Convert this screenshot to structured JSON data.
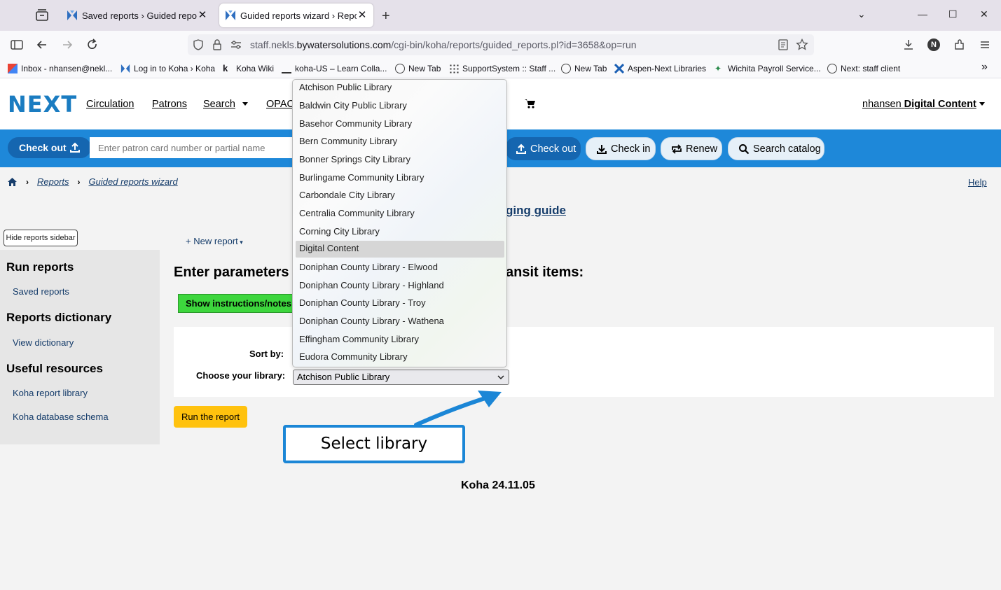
{
  "browser": {
    "tabs": [
      {
        "title": "Saved reports › Guided reports › Reports",
        "active": false
      },
      {
        "title": "Guided reports wizard › Reports",
        "active": true
      }
    ],
    "url": {
      "prefix": "staff.nekls.",
      "domain": "bywatersolutions.com",
      "path": "/cgi-bin/koha/reports/guided_reports.pl?id=3658&op=run"
    },
    "profile_initial": "N",
    "bookmarks": [
      "Inbox - nhansen@nekl...",
      "Log in to Koha › Koha",
      "Koha Wiki",
      "koha-US – Learn Colla...",
      "New Tab",
      "SupportSystem :: Staff ...",
      "New Tab",
      "Aspen-Next Libraries",
      "Wichita Payroll Service...",
      "Next: staff client"
    ]
  },
  "koha": {
    "logo": "NEXT",
    "nav": [
      "Circulation",
      "Patrons",
      "Search",
      "OPAC"
    ],
    "user": {
      "name": "nhansen",
      "branch": "Digital Content"
    },
    "checkout_label": "Check out",
    "patron_placeholder": "Enter patron card number or partial name",
    "bluebar_buttons": [
      "Check out",
      "Check in",
      "Renew",
      "Search catalog"
    ],
    "breadcrumb": [
      "Reports",
      "Guided reports wizard"
    ],
    "help": "Help",
    "guide_fragment": "ging guide",
    "hide_sidebar": "Hide reports sidebar",
    "sidebar": {
      "run_reports": "Run reports",
      "saved_reports": "Saved reports",
      "dictionary": "Reports dictionary",
      "view_dictionary": "View dictionary",
      "useful": "Useful resources",
      "report_library": "Koha report library",
      "db_schema": "Koha database schema"
    },
    "new_report": "New report",
    "heading_left": "Enter parameters",
    "heading_right": "ansit items:",
    "show_instructions": "Show instructions/notes",
    "sort_by_label": "Sort by:",
    "library_label": "Choose your library:",
    "selected_library": "Atchison Public Library",
    "run_report": "Run the report",
    "callout": "Select library",
    "version": "Koha 24.11.05"
  },
  "dropdown_options": [
    "Atchison Public Library",
    "Baldwin City Public Library",
    "Basehor Community Library",
    "Bern Community Library",
    "Bonner Springs City Library",
    "Burlingame Community Library",
    "Carbondale City Library",
    "Centralia Community Library",
    "Corning City Library",
    "Digital Content",
    "Doniphan County Library - Elwood",
    "Doniphan County Library - Highland",
    "Doniphan County Library - Troy",
    "Doniphan County Library - Wathena",
    "Effingham Community Library",
    "Eudora Community Library"
  ],
  "highlighted_option": "Digital Content",
  "colors": {
    "koha_blue": "#1e88d9",
    "green_button": "#3dd63d",
    "run_button": "#ffc20e",
    "callout_border": "#1b86d6"
  }
}
